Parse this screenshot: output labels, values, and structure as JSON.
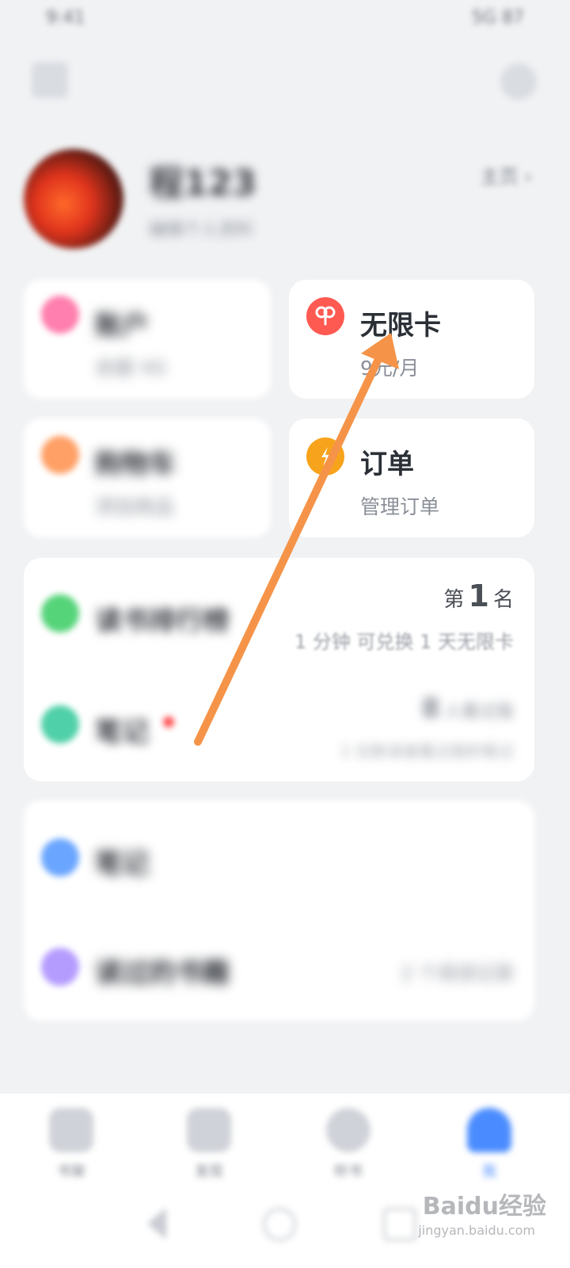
{
  "status_bar": {
    "left": "9:41 ",
    "right": "5G 87"
  },
  "profile": {
    "name": "程123",
    "subtitle": "编辑个人资料",
    "homepage_label": "主页"
  },
  "cards": [
    {
      "title": "账户",
      "subtitle": "余额 ¥0",
      "icon_color": "#ff7fae"
    },
    {
      "title": "无限卡",
      "subtitle": "9元/月",
      "icon_color": "#ff5a52"
    },
    {
      "title": "购物车",
      "subtitle": "添加商品",
      "icon_color": "#ffa066"
    },
    {
      "title": "订单",
      "subtitle": "管理订单",
      "icon_color": "#f7a31c"
    }
  ],
  "rank": {
    "label": "读书排行榜",
    "prefix": "第",
    "value": "1",
    "suffix": "名",
    "desc": "1 分钟 可兑换 1 天无限卡"
  },
  "notes": {
    "label": "笔记",
    "count": "8",
    "count_suffix": "人看过我",
    "desc": "1 位新读者看过我的笔记"
  },
  "history": [
    {
      "label": "笔记",
      "value": "",
      "icon_color": "#6aa6ff"
    },
    {
      "label": "读过的书籍",
      "value": "2 个阅读记录",
      "icon_color": "#b49cff"
    }
  ],
  "bottom_nav": [
    {
      "label": "书架"
    },
    {
      "label": "发现"
    },
    {
      "label": "听书"
    },
    {
      "label": "我"
    }
  ],
  "watermark": {
    "main": "Baidu经验",
    "sub": "jingyan.baidu.com"
  },
  "annotation": {
    "arrow_color": "#f59449"
  }
}
